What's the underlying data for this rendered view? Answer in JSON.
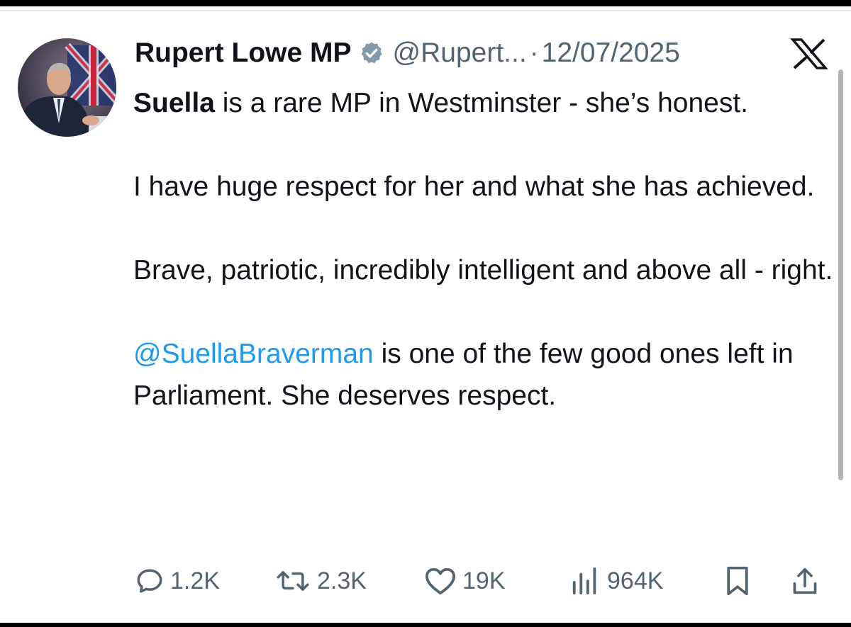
{
  "tweet": {
    "author_name": "Rupert Lowe MP",
    "handle": "@Rupert...",
    "separator": "·",
    "date": "12/07/2025",
    "paragraphs": [
      {
        "bold_lead": "Suella",
        "text": " is a rare MP in Westminster - she’s honest."
      },
      {
        "text": "I have huge respect for her and what she has achieved."
      },
      {
        "text": "Brave, patriotic, incredibly intelligent and above all - right."
      },
      {
        "mention": "@SuellaBraverman",
        "text": " is one of the few good ones left in Parliament. She deserves respect."
      }
    ]
  },
  "actions": {
    "replies": "1.2K",
    "reposts": "2.3K",
    "likes": "19K",
    "views": "964K"
  },
  "icons": {
    "verified": "verified-badge-icon",
    "platform": "x-logo-icon",
    "reply": "reply-icon",
    "repost": "repost-icon",
    "like": "heart-icon",
    "views": "views-chart-icon",
    "bookmark": "bookmark-icon",
    "share": "share-icon"
  },
  "colors": {
    "text": "#0f1419",
    "secondary": "#536471",
    "mention": "#1d9bf0",
    "verified_badge": "#829aab"
  }
}
